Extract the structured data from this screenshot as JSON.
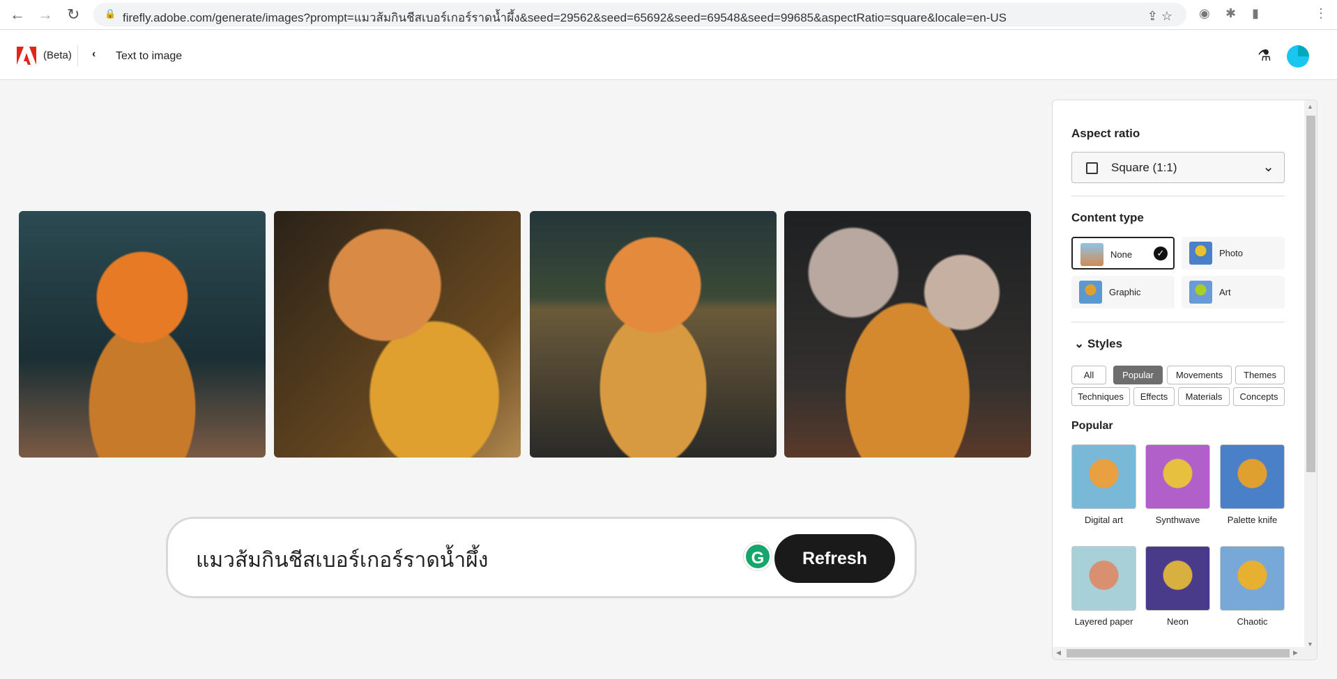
{
  "browser": {
    "url": "firefly.adobe.com/generate/images?prompt=แมวส้มกินชีสเบอร์เกอร์ราดน้ำผึ้ง&seed=29562&seed=65692&seed=69548&seed=99685&aspectRatio=square&locale=en-US"
  },
  "header": {
    "beta": "(Beta)",
    "title": "Text to image"
  },
  "prompt": {
    "text": "แมวส้มกินชีสเบอร์เกอร์ราดน้ำผึ้ง",
    "refresh": "Refresh",
    "grammarly": "G"
  },
  "panel": {
    "aspect_title": "Aspect ratio",
    "aspect_value": "Square (1:1)",
    "content_title": "Content type",
    "content_types": [
      {
        "label": "None",
        "selected": true
      },
      {
        "label": "Photo"
      },
      {
        "label": "Graphic"
      },
      {
        "label": "Art"
      }
    ],
    "styles_title": "Styles",
    "chips": [
      "All",
      "Popular",
      "Movements",
      "Themes",
      "Techniques",
      "Effects",
      "Materials",
      "Concepts"
    ],
    "active_chip": "Popular",
    "popular_title": "Popular",
    "styles": [
      "Digital art",
      "Synthwave",
      "Palette knife",
      "Layered paper",
      "Neon",
      "Chaotic"
    ]
  }
}
